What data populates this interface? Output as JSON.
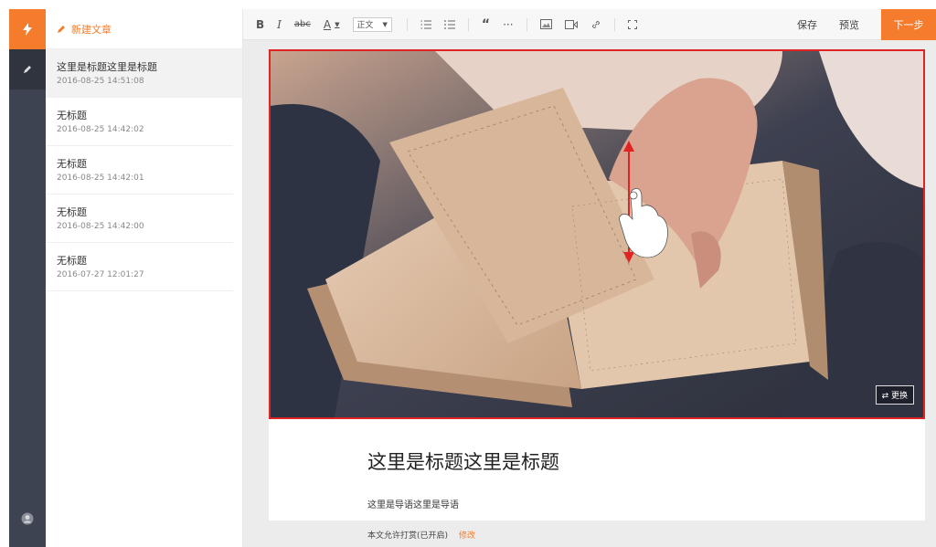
{
  "rail": {
    "items": [
      "bolt-icon",
      "pencil-icon",
      "avatar-icon"
    ],
    "accent": "#f47c2c"
  },
  "list": {
    "new_article_label": "新建文章",
    "items": [
      {
        "title": "这里是标题这里是标题",
        "date": "2016-08-25 14:51:08"
      },
      {
        "title": "无标题",
        "date": "2016-08-25 14:42:02"
      },
      {
        "title": "无标题",
        "date": "2016-08-25 14:42:01"
      },
      {
        "title": "无标题",
        "date": "2016-08-25 14:42:00"
      },
      {
        "title": "无标题",
        "date": "2016-07-27 12:01:27"
      }
    ]
  },
  "toolbar": {
    "bold": "B",
    "italic": "I",
    "strike": "abc",
    "font_color": "A",
    "paragraph_select": "正文",
    "quote": "“",
    "more": "···",
    "save_label": "保存",
    "preview_label": "预览",
    "next_label": "下一步"
  },
  "article": {
    "replace_label": "⇄ 更换",
    "title": "这里是标题这里是标题",
    "lead": "这里是导语这里是导语"
  },
  "footer": {
    "reward_text": "本文允许打赏(已开启)",
    "modify_label": "修改"
  }
}
